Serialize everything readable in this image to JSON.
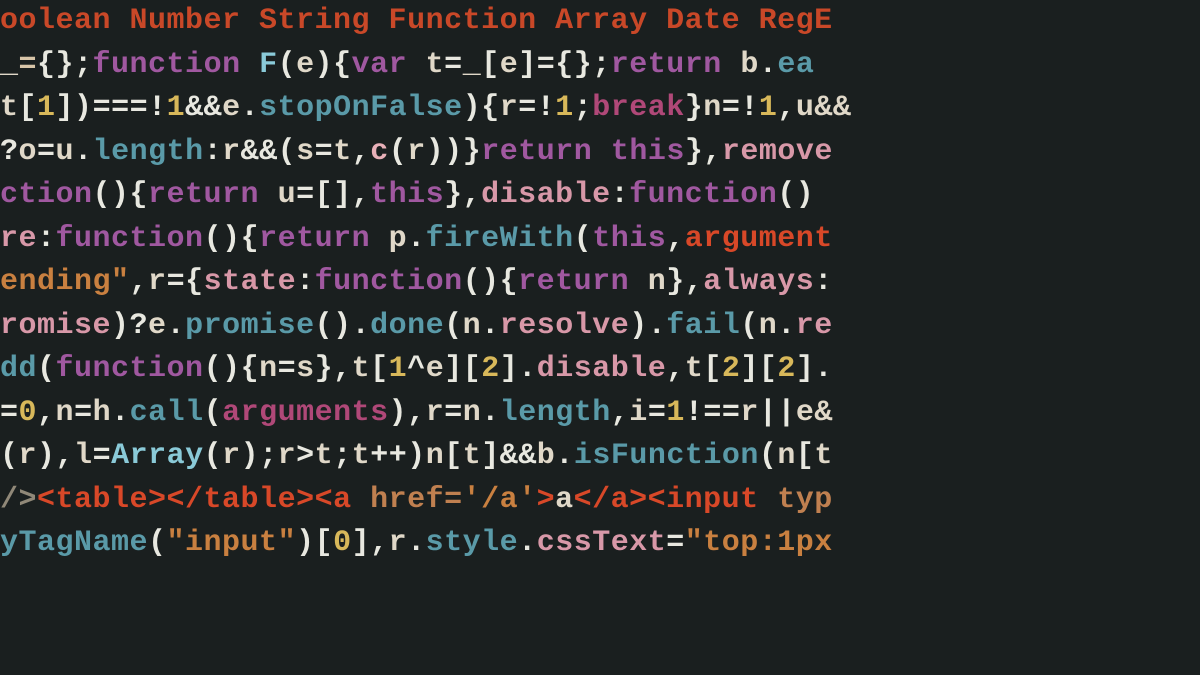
{
  "lines": [
    {
      "tokens": [
        {
          "t": "oolean Number String Function Array Date RegE",
          "c": "type"
        }
      ]
    },
    {
      "tokens": [
        {
          "t": "_",
          "c": "id"
        },
        {
          "t": "=",
          "c": "op"
        },
        {
          "t": "{};",
          "c": "white"
        },
        {
          "t": "function",
          "c": "kw"
        },
        {
          "t": " F",
          "c": "cyan"
        },
        {
          "t": "(",
          "c": "white"
        },
        {
          "t": "e",
          "c": "id"
        },
        {
          "t": "){",
          "c": "white"
        },
        {
          "t": "var",
          "c": "kw"
        },
        {
          "t": " t",
          "c": "id"
        },
        {
          "t": "=",
          "c": "white"
        },
        {
          "t": "_",
          "c": "id"
        },
        {
          "t": "[",
          "c": "white"
        },
        {
          "t": "e",
          "c": "id"
        },
        {
          "t": "]",
          "c": "white"
        },
        {
          "t": "=",
          "c": "white"
        },
        {
          "t": "{};",
          "c": "white"
        },
        {
          "t": "return",
          "c": "kw"
        },
        {
          "t": " b",
          "c": "id"
        },
        {
          "t": ".",
          "c": "white"
        },
        {
          "t": "ea",
          "c": "blue"
        }
      ]
    },
    {
      "tokens": [
        {
          "t": "t",
          "c": "id"
        },
        {
          "t": "[",
          "c": "white"
        },
        {
          "t": "1",
          "c": "num"
        },
        {
          "t": "])",
          "c": "white"
        },
        {
          "t": "===!",
          "c": "white"
        },
        {
          "t": "1",
          "c": "num"
        },
        {
          "t": "&&",
          "c": "white"
        },
        {
          "t": "e",
          "c": "id"
        },
        {
          "t": ".",
          "c": "white"
        },
        {
          "t": "stopOnFalse",
          "c": "blue"
        },
        {
          "t": "){",
          "c": "white"
        },
        {
          "t": "r",
          "c": "id"
        },
        {
          "t": "=!",
          "c": "white"
        },
        {
          "t": "1",
          "c": "num"
        },
        {
          "t": ";",
          "c": "white"
        },
        {
          "t": "break",
          "c": "kw2"
        },
        {
          "t": "}",
          "c": "white"
        },
        {
          "t": "n",
          "c": "id"
        },
        {
          "t": "=!",
          "c": "white"
        },
        {
          "t": "1",
          "c": "num"
        },
        {
          "t": ",",
          "c": "white"
        },
        {
          "t": "u&&",
          "c": "id"
        }
      ]
    },
    {
      "tokens": [
        {
          "t": "?",
          "c": "white"
        },
        {
          "t": "o",
          "c": "id"
        },
        {
          "t": "=",
          "c": "white"
        },
        {
          "t": "u",
          "c": "id"
        },
        {
          "t": ".",
          "c": "white"
        },
        {
          "t": "length",
          "c": "blue"
        },
        {
          "t": ":",
          "c": "white"
        },
        {
          "t": "r",
          "c": "id"
        },
        {
          "t": "&&(",
          "c": "white"
        },
        {
          "t": "s",
          "c": "id"
        },
        {
          "t": "=",
          "c": "white"
        },
        {
          "t": "t",
          "c": "id"
        },
        {
          "t": ",",
          "c": "white"
        },
        {
          "t": "c",
          "c": "fn"
        },
        {
          "t": "(",
          "c": "white"
        },
        {
          "t": "r",
          "c": "id"
        },
        {
          "t": "))}",
          "c": "white"
        },
        {
          "t": "return",
          "c": "kw"
        },
        {
          "t": " this",
          "c": "kw"
        },
        {
          "t": "},",
          "c": "white"
        },
        {
          "t": "remove",
          "c": "pink2"
        }
      ]
    },
    {
      "tokens": [
        {
          "t": "ction",
          "c": "kw"
        },
        {
          "t": "(){",
          "c": "white"
        },
        {
          "t": "return",
          "c": "kw"
        },
        {
          "t": " u",
          "c": "id"
        },
        {
          "t": "=[],",
          "c": "white"
        },
        {
          "t": "this",
          "c": "kw"
        },
        {
          "t": "},",
          "c": "white"
        },
        {
          "t": "disable",
          "c": "pink2"
        },
        {
          "t": ":",
          "c": "white"
        },
        {
          "t": "function",
          "c": "kw"
        },
        {
          "t": "()",
          "c": "white"
        }
      ]
    },
    {
      "tokens": [
        {
          "t": "re",
          "c": "pink2"
        },
        {
          "t": ":",
          "c": "white"
        },
        {
          "t": "function",
          "c": "kw"
        },
        {
          "t": "(){",
          "c": "white"
        },
        {
          "t": "return",
          "c": "kw"
        },
        {
          "t": " p",
          "c": "id"
        },
        {
          "t": ".",
          "c": "white"
        },
        {
          "t": "fireWith",
          "c": "blue"
        },
        {
          "t": "(",
          "c": "white"
        },
        {
          "t": "this",
          "c": "kw"
        },
        {
          "t": ",",
          "c": "white"
        },
        {
          "t": "argument",
          "c": "red"
        }
      ]
    },
    {
      "tokens": [
        {
          "t": "ending\"",
          "c": "str"
        },
        {
          "t": ",",
          "c": "white"
        },
        {
          "t": "r",
          "c": "id"
        },
        {
          "t": "={",
          "c": "white"
        },
        {
          "t": "state",
          "c": "pink2"
        },
        {
          "t": ":",
          "c": "white"
        },
        {
          "t": "function",
          "c": "kw"
        },
        {
          "t": "(){",
          "c": "white"
        },
        {
          "t": "return",
          "c": "kw"
        },
        {
          "t": " n",
          "c": "id"
        },
        {
          "t": "},",
          "c": "white"
        },
        {
          "t": "always",
          "c": "pink2"
        },
        {
          "t": ":",
          "c": "white"
        }
      ]
    },
    {
      "tokens": [
        {
          "t": "romise",
          "c": "pink2"
        },
        {
          "t": ")?",
          "c": "white"
        },
        {
          "t": "e",
          "c": "id"
        },
        {
          "t": ".",
          "c": "white"
        },
        {
          "t": "promise",
          "c": "blue"
        },
        {
          "t": "().",
          "c": "white"
        },
        {
          "t": "done",
          "c": "blue"
        },
        {
          "t": "(",
          "c": "white"
        },
        {
          "t": "n",
          "c": "id"
        },
        {
          "t": ".",
          "c": "white"
        },
        {
          "t": "resolve",
          "c": "pink2"
        },
        {
          "t": ").",
          "c": "white"
        },
        {
          "t": "fail",
          "c": "blue"
        },
        {
          "t": "(",
          "c": "white"
        },
        {
          "t": "n",
          "c": "id"
        },
        {
          "t": ".",
          "c": "white"
        },
        {
          "t": "re",
          "c": "pink2"
        }
      ]
    },
    {
      "tokens": [
        {
          "t": "dd",
          "c": "blue"
        },
        {
          "t": "(",
          "c": "white"
        },
        {
          "t": "function",
          "c": "kw"
        },
        {
          "t": "(){",
          "c": "white"
        },
        {
          "t": "n",
          "c": "id"
        },
        {
          "t": "=",
          "c": "white"
        },
        {
          "t": "s",
          "c": "id"
        },
        {
          "t": "},",
          "c": "white"
        },
        {
          "t": "t",
          "c": "id"
        },
        {
          "t": "[",
          "c": "white"
        },
        {
          "t": "1",
          "c": "num"
        },
        {
          "t": "^",
          "c": "white"
        },
        {
          "t": "e",
          "c": "id"
        },
        {
          "t": "][",
          "c": "white"
        },
        {
          "t": "2",
          "c": "num"
        },
        {
          "t": "].",
          "c": "white"
        },
        {
          "t": "disable",
          "c": "pink2"
        },
        {
          "t": ",",
          "c": "white"
        },
        {
          "t": "t",
          "c": "id"
        },
        {
          "t": "[",
          "c": "white"
        },
        {
          "t": "2",
          "c": "num"
        },
        {
          "t": "][",
          "c": "white"
        },
        {
          "t": "2",
          "c": "num"
        },
        {
          "t": "].",
          "c": "white"
        }
      ]
    },
    {
      "tokens": [
        {
          "t": "=",
          "c": "white"
        },
        {
          "t": "0",
          "c": "num"
        },
        {
          "t": ",",
          "c": "white"
        },
        {
          "t": "n",
          "c": "id"
        },
        {
          "t": "=",
          "c": "white"
        },
        {
          "t": "h",
          "c": "id"
        },
        {
          "t": ".",
          "c": "white"
        },
        {
          "t": "call",
          "c": "blue"
        },
        {
          "t": "(",
          "c": "white"
        },
        {
          "t": "arguments",
          "c": "kw2"
        },
        {
          "t": "),",
          "c": "white"
        },
        {
          "t": "r",
          "c": "id"
        },
        {
          "t": "=",
          "c": "white"
        },
        {
          "t": "n",
          "c": "id"
        },
        {
          "t": ".",
          "c": "white"
        },
        {
          "t": "length",
          "c": "blue"
        },
        {
          "t": ",",
          "c": "white"
        },
        {
          "t": "i",
          "c": "id"
        },
        {
          "t": "=",
          "c": "white"
        },
        {
          "t": "1",
          "c": "num"
        },
        {
          "t": "!==",
          "c": "white"
        },
        {
          "t": "r",
          "c": "id"
        },
        {
          "t": "||",
          "c": "white"
        },
        {
          "t": "e&",
          "c": "id"
        }
      ]
    },
    {
      "tokens": [
        {
          "t": "(",
          "c": "white"
        },
        {
          "t": "r",
          "c": "id"
        },
        {
          "t": "),",
          "c": "white"
        },
        {
          "t": "l",
          "c": "id"
        },
        {
          "t": "=",
          "c": "white"
        },
        {
          "t": "Array",
          "c": "cyan"
        },
        {
          "t": "(",
          "c": "white"
        },
        {
          "t": "r",
          "c": "id"
        },
        {
          "t": ");",
          "c": "white"
        },
        {
          "t": "r",
          "c": "id"
        },
        {
          "t": ">",
          "c": "white"
        },
        {
          "t": "t",
          "c": "id"
        },
        {
          "t": ";",
          "c": "white"
        },
        {
          "t": "t",
          "c": "id"
        },
        {
          "t": "++)",
          "c": "white"
        },
        {
          "t": "n",
          "c": "id"
        },
        {
          "t": "[",
          "c": "white"
        },
        {
          "t": "t",
          "c": "id"
        },
        {
          "t": "]&&",
          "c": "white"
        },
        {
          "t": "b",
          "c": "id"
        },
        {
          "t": ".",
          "c": "white"
        },
        {
          "t": "isFunction",
          "c": "blue"
        },
        {
          "t": "(",
          "c": "white"
        },
        {
          "t": "n",
          "c": "id"
        },
        {
          "t": "[",
          "c": "white"
        },
        {
          "t": "t",
          "c": "id"
        }
      ]
    },
    {
      "tokens": [
        {
          "t": "/>",
          "c": "dim"
        },
        {
          "t": "<table>",
          "c": "red"
        },
        {
          "t": "</table>",
          "c": "red"
        },
        {
          "t": "<a ",
          "c": "red"
        },
        {
          "t": "href=",
          "c": "tag"
        },
        {
          "t": "'/a'",
          "c": "str"
        },
        {
          "t": ">",
          "c": "red"
        },
        {
          "t": "a",
          "c": "id"
        },
        {
          "t": "</a>",
          "c": "red"
        },
        {
          "t": "<input ",
          "c": "red"
        },
        {
          "t": "typ",
          "c": "tag"
        }
      ]
    },
    {
      "tokens": [
        {
          "t": "yTagName",
          "c": "blue"
        },
        {
          "t": "(",
          "c": "white"
        },
        {
          "t": "\"input\"",
          "c": "str"
        },
        {
          "t": ")[",
          "c": "white"
        },
        {
          "t": "0",
          "c": "num"
        },
        {
          "t": "],",
          "c": "white"
        },
        {
          "t": "r",
          "c": "id"
        },
        {
          "t": ".",
          "c": "white"
        },
        {
          "t": "style",
          "c": "blue"
        },
        {
          "t": ".",
          "c": "white"
        },
        {
          "t": "cssText",
          "c": "pink2"
        },
        {
          "t": "=",
          "c": "white"
        },
        {
          "t": "\"top:1px",
          "c": "str"
        }
      ]
    }
  ]
}
